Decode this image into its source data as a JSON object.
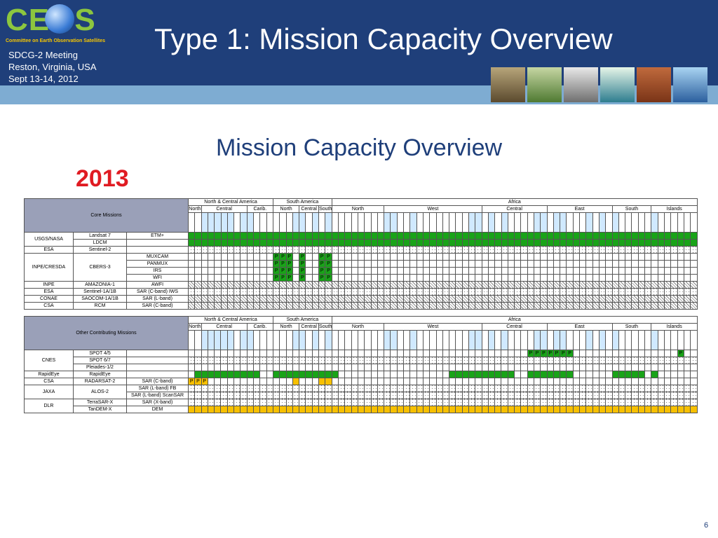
{
  "header": {
    "org_logo": "CEOS",
    "org_tagline": "Committee on Earth Observation Satellites",
    "meeting_lines": [
      "SDCG-2 Meeting",
      "Reston, Virginia, USA",
      "Sept 13-14, 2012"
    ],
    "title": "Type 1: Mission Capacity Overview"
  },
  "subtitle": "Mission Capacity Overview",
  "year": "2013",
  "page_number": "6",
  "regions": {
    "groups": [
      {
        "label": "North & Central America",
        "span": 13
      },
      {
        "label": "South America",
        "span": 9
      },
      {
        "label": "Africa",
        "span": 56
      }
    ],
    "subregions": [
      {
        "label": "North",
        "span": 2
      },
      {
        "label": "Central",
        "span": 7
      },
      {
        "label": "Carib.",
        "span": 4
      },
      {
        "label": "North",
        "span": 4
      },
      {
        "label": "Central",
        "span": 3
      },
      {
        "label": "South",
        "span": 2
      },
      {
        "label": "North",
        "span": 8
      },
      {
        "label": "West",
        "span": 15
      },
      {
        "label": "Central",
        "span": 10
      },
      {
        "label": "East",
        "span": 10
      },
      {
        "label": "South",
        "span": 6
      },
      {
        "label": "Islands",
        "span": 7
      }
    ]
  },
  "table1": {
    "corner": "Core Missions",
    "rows": [
      {
        "agency": "USGS/NASA",
        "mission": "Landsat 7",
        "sensor": "ETM+",
        "pattern": "green"
      },
      {
        "agency": "",
        "mission": "LDCM",
        "sensor": "",
        "pattern": "green"
      },
      {
        "agency": "ESA",
        "mission": "Sentinel-2",
        "sensor": "",
        "pattern": "dots"
      },
      {
        "agency": "INPE/CRESDA",
        "mission": "CBERS-3",
        "sensor": "MUXCAM",
        "pattern": "p"
      },
      {
        "agency": "",
        "mission": "",
        "sensor": "PANMUX",
        "pattern": "p"
      },
      {
        "agency": "",
        "mission": "",
        "sensor": "IRS",
        "pattern": "p"
      },
      {
        "agency": "",
        "mission": "",
        "sensor": "WFI",
        "pattern": "p"
      },
      {
        "agency": "INPE",
        "mission": "AMAZONIA-1",
        "sensor": "AWFI",
        "pattern": "hatch"
      },
      {
        "agency": "ESA",
        "mission": "Sentinel-1A/1B",
        "sensor": "SAR (C-band) IWS",
        "pattern": "dots"
      },
      {
        "agency": "CONAE",
        "mission": "SAOCOM-1A/1B",
        "sensor": "SAR (L-band)",
        "pattern": "hatch"
      },
      {
        "agency": "CSA",
        "mission": "RCM",
        "sensor": "SAR (C-band)",
        "pattern": "hatch"
      }
    ]
  },
  "table2": {
    "corner": "Other Contributing Missions",
    "rows": [
      {
        "agency": "CNES",
        "mission": "SPOT 4/5",
        "sensor": "",
        "pattern": "spot45"
      },
      {
        "agency": "",
        "mission": "SPOT 6/7",
        "sensor": "",
        "pattern": "dots"
      },
      {
        "agency": "",
        "mission": "Pleiades-1/2",
        "sensor": "",
        "pattern": "blank"
      },
      {
        "agency": "RapidEye",
        "mission": "RapidEye",
        "sensor": "",
        "pattern": "rapideye"
      },
      {
        "agency": "CSA",
        "mission": "RADARSAT-2",
        "sensor": "SAR (C-band)",
        "pattern": "radarsat"
      },
      {
        "agency": "JAXA",
        "mission": "ALOS-2",
        "sensor": "SAR (L-band) FB",
        "pattern": "dots"
      },
      {
        "agency": "",
        "mission": "",
        "sensor": "SAR (L-band) ScanSAR",
        "pattern": "dots"
      },
      {
        "agency": "DLR",
        "mission": "TerraSAR-X",
        "sensor": "SAR (X-band)",
        "pattern": "dots"
      },
      {
        "agency": "",
        "mission": "TanDEM-X",
        "sensor": "DEM",
        "pattern": "orange"
      }
    ]
  },
  "colors": {
    "header": "#1f3f7a",
    "band": "#7eacd2",
    "acquired": "#19a318",
    "planned": "#f7c000",
    "year": "#e01b22"
  }
}
